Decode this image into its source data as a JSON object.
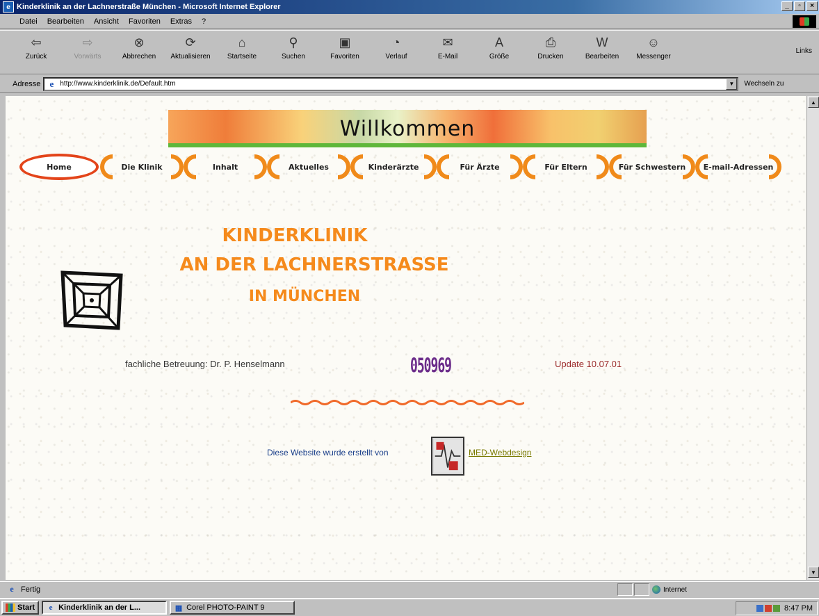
{
  "window": {
    "title": "Kinderklinik an der Lachnerstraße München - Microsoft Internet Explorer"
  },
  "menu": [
    "Datei",
    "Bearbeiten",
    "Ansicht",
    "Favoriten",
    "Extras",
    "?"
  ],
  "toolbar": {
    "buttons": [
      {
        "label": "Zurück",
        "icon": "back-arrow-icon"
      },
      {
        "label": "Vorwärts",
        "icon": "forward-arrow-icon"
      },
      {
        "label": "Abbrechen",
        "icon": "stop-icon"
      },
      {
        "label": "Aktualisieren",
        "icon": "refresh-icon"
      },
      {
        "label": "Startseite",
        "icon": "home-icon"
      },
      {
        "label": "Suchen",
        "icon": "search-icon"
      },
      {
        "label": "Favoriten",
        "icon": "favorites-icon"
      },
      {
        "label": "Verlauf",
        "icon": "history-icon"
      },
      {
        "label": "E-Mail",
        "icon": "mail-icon"
      },
      {
        "label": "Größe",
        "icon": "font-size-icon"
      },
      {
        "label": "Drucken",
        "icon": "print-icon"
      },
      {
        "label": "Bearbeiten",
        "icon": "edit-icon"
      },
      {
        "label": "Messenger",
        "icon": "messenger-icon"
      }
    ],
    "links_label": "Links"
  },
  "address": {
    "label": "Adresse",
    "url": "http://www.kinderklinik.de/Default.htm",
    "go_label": "Wechseln zu"
  },
  "page": {
    "banner_title": "Willkommen",
    "nav": [
      "Home",
      "Die Klinik",
      "Inhalt",
      "Aktuelles",
      "Kinderärzte",
      "Für Ärzte",
      "Für Eltern",
      "Für Schwestern",
      "E-mail-Adressen"
    ],
    "heading_line1": "KINDERKLINIK",
    "heading_line2": "AN DER LACHNERSTRASSE",
    "heading_line3": "IN MÜNCHEN",
    "fachlich": "fachliche Betreuung: Dr. P. Henselmann",
    "counter": "050969",
    "update": "Update 10.07.01",
    "credit_text": "Diese Website wurde erstellt von",
    "credit_link": "MED-Webdesign",
    "colors": {
      "heading": "#f58a1c",
      "nav_bracket": "#f08a1a",
      "home_oval": "#e3441a",
      "update_text": "#9b2a2a",
      "counter": "#6b2c8a"
    }
  },
  "status": {
    "text": "Fertig",
    "zone": "Internet"
  },
  "taskbar": {
    "start": "Start",
    "items": [
      "Kinderklinik an der L...",
      "Corel PHOTO-PAINT 9"
    ],
    "clock": "8:47 PM"
  }
}
